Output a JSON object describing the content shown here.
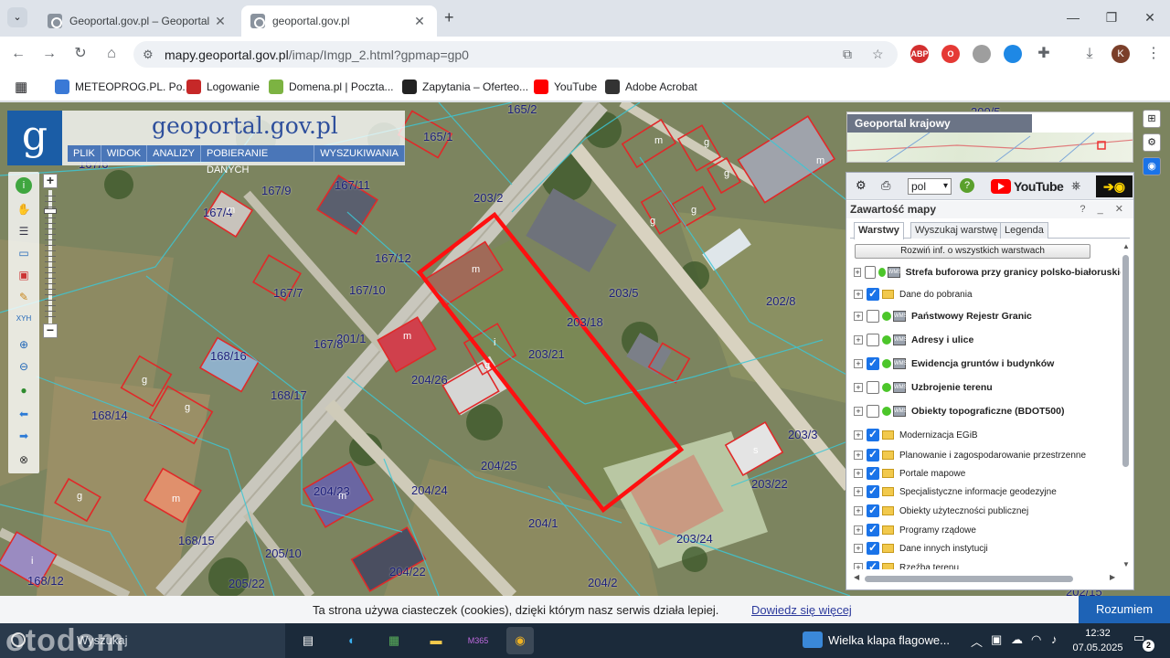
{
  "browser": {
    "tabs": [
      {
        "title": "Geoportal.gov.pl – Geoportal krajowy",
        "active": false
      },
      {
        "title": "geoportal.gov.pl",
        "active": true
      }
    ],
    "new_tab": "+",
    "url_domain": "mapy.geoportal.gov.pl",
    "url_path": "/imap/Imgp_2.html?gpmap=gp0",
    "profile_initial": "K",
    "bookmarks": [
      {
        "label": "METEOPROG.PL. Po...",
        "color": "#3a79d6"
      },
      {
        "label": "Logowanie",
        "color": "#c62828"
      },
      {
        "label": "Domena.pl | Poczta...",
        "color": "#7cb342"
      },
      {
        "label": "Zapytania – Oferteo...",
        "color": "#222222"
      },
      {
        "label": "YouTube",
        "color": "#ff0000"
      },
      {
        "label": "Adobe Acrobat",
        "color": "#333333"
      }
    ],
    "extensions": [
      {
        "label": "ABP",
        "color": "#d32f2f"
      },
      {
        "label": "O",
        "color": "#e53935"
      },
      {
        "label": "",
        "color": "#9e9e9e"
      },
      {
        "label": "",
        "color": "#1e88e5"
      }
    ]
  },
  "geoportal": {
    "logo_letter": "g",
    "site_name": "geoportal.gov.pl",
    "menu": [
      "PLIK",
      "WIDOK",
      "ANALIZY",
      "POBIERANIE DANYCH",
      "WYSZUKIWANIA"
    ],
    "overview_title": "Geoportal krajowy",
    "language": "pol",
    "youtube_label": "YouTube",
    "panel_title": "Zawartość mapy",
    "panel_controls": "? _ ✕",
    "panel_tabs": [
      "Warstwy",
      "Wyszukaj warstwę",
      "Legenda"
    ],
    "expand_button": "Rozwiń inf. o wszystkich warstwach",
    "layers": [
      {
        "label": "Strefa buforowa przy granicy polsko-białoruskiej",
        "checked": false,
        "bold": true,
        "type": "service"
      },
      {
        "label": "Dane do pobrania",
        "checked": true,
        "bold": false,
        "type": "folder"
      },
      {
        "label": "Państwowy Rejestr Granic",
        "checked": false,
        "bold": true,
        "type": "service"
      },
      {
        "label": "Adresy i ulice",
        "checked": false,
        "bold": true,
        "type": "service"
      },
      {
        "label": "Ewidencja gruntów i budynków",
        "checked": true,
        "bold": true,
        "type": "service"
      },
      {
        "label": "Uzbrojenie terenu",
        "checked": false,
        "bold": true,
        "type": "service"
      },
      {
        "label": "Obiekty topograficzne (BDOT500)",
        "checked": false,
        "bold": true,
        "type": "service"
      },
      {
        "label": "Modernizacja EGiB",
        "checked": true,
        "bold": false,
        "type": "folder"
      },
      {
        "label": "Planowanie i zagospodarowanie przestrzenne",
        "checked": true,
        "bold": false,
        "type": "folder"
      },
      {
        "label": "Portale mapowe",
        "checked": true,
        "bold": false,
        "type": "folder"
      },
      {
        "label": "Specjalistyczne informacje geodezyjne",
        "checked": true,
        "bold": false,
        "type": "folder"
      },
      {
        "label": "Obiekty użyteczności publicznej",
        "checked": true,
        "bold": false,
        "type": "folder"
      },
      {
        "label": "Programy rządowe",
        "checked": true,
        "bold": false,
        "type": "folder"
      },
      {
        "label": "Dane innych instytucji",
        "checked": true,
        "bold": false,
        "type": "folder"
      },
      {
        "label": "Rzeźba terenu",
        "checked": true,
        "bold": false,
        "type": "folder"
      }
    ],
    "parcel_labels": [
      "165/2",
      "165/1",
      "200/5",
      "167/6",
      "167/9",
      "167/11",
      "167/4",
      "203/2",
      "167/12",
      "167/7",
      "167/10",
      "203/5",
      "202/8",
      "203/18",
      "201/1",
      "167/8",
      "203/21",
      "168/16",
      "204/26",
      "168/17",
      "168/14",
      "203/3",
      "204/25",
      "203/22",
      "204/23",
      "204/24",
      "204/1",
      "168/15",
      "205/10",
      "203/24",
      "168/12",
      "205/22",
      "204/22",
      "204/2",
      "202/15"
    ],
    "building_letters": [
      "m",
      "g",
      "g",
      "m",
      "g",
      "g",
      "m",
      "m",
      "i",
      "m",
      "g",
      "g",
      "g",
      "m",
      "s",
      "g",
      "m",
      "i"
    ]
  },
  "cookie": {
    "text": "Ta strona używa ciasteczek (cookies), dzięki którym nasz serwis działa lepiej.",
    "link": "Dowiedz się więcej",
    "accept": "Rozumiem"
  },
  "taskbar": {
    "search_placeholder": "Wyszukaj",
    "watermark": "otodom",
    "weather": "Wielka klapa flagowe...",
    "time": "12:32",
    "date": "07.05.2025",
    "notifications": "2"
  }
}
